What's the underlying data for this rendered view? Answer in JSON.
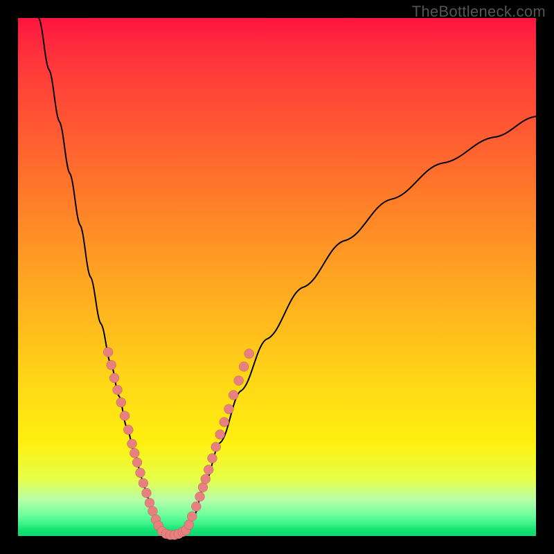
{
  "watermark": "TheBottleneck.com",
  "chart_data": {
    "type": "line",
    "title": "",
    "xlabel": "",
    "ylabel": "",
    "xlim": [
      0,
      1
    ],
    "ylim": [
      0,
      1
    ],
    "background_gradient": [
      "#ff143f",
      "#ff7a2a",
      "#ffd617",
      "#fff010",
      "#12d86f"
    ],
    "series": [
      {
        "name": "left-branch",
        "x": [
          0.04,
          0.06,
          0.08,
          0.1,
          0.12,
          0.14,
          0.16,
          0.18,
          0.195,
          0.21,
          0.225,
          0.24,
          0.25,
          0.26,
          0.268,
          0.276
        ],
        "y": [
          1.0,
          0.9,
          0.8,
          0.7,
          0.6,
          0.5,
          0.41,
          0.33,
          0.27,
          0.21,
          0.16,
          0.11,
          0.075,
          0.045,
          0.022,
          0.01
        ]
      },
      {
        "name": "valley-floor",
        "x": [
          0.276,
          0.285,
          0.295,
          0.305,
          0.315,
          0.326
        ],
        "y": [
          0.01,
          0.004,
          0.002,
          0.002,
          0.004,
          0.01
        ]
      },
      {
        "name": "right-branch",
        "x": [
          0.326,
          0.34,
          0.36,
          0.39,
          0.43,
          0.48,
          0.55,
          0.63,
          0.72,
          0.82,
          0.92,
          1.0
        ],
        "y": [
          0.01,
          0.04,
          0.1,
          0.18,
          0.28,
          0.38,
          0.48,
          0.57,
          0.65,
          0.72,
          0.77,
          0.81
        ]
      }
    ],
    "dots_left": [
      {
        "x": 0.174,
        "y": 0.355
      },
      {
        "x": 0.18,
        "y": 0.33
      },
      {
        "x": 0.186,
        "y": 0.305
      },
      {
        "x": 0.192,
        "y": 0.282
      },
      {
        "x": 0.199,
        "y": 0.258
      },
      {
        "x": 0.206,
        "y": 0.232
      },
      {
        "x": 0.213,
        "y": 0.205
      },
      {
        "x": 0.22,
        "y": 0.178
      },
      {
        "x": 0.225,
        "y": 0.16
      },
      {
        "x": 0.23,
        "y": 0.142
      },
      {
        "x": 0.236,
        "y": 0.122
      },
      {
        "x": 0.242,
        "y": 0.102
      },
      {
        "x": 0.248,
        "y": 0.083
      },
      {
        "x": 0.254,
        "y": 0.064
      },
      {
        "x": 0.26,
        "y": 0.048
      },
      {
        "x": 0.266,
        "y": 0.032
      },
      {
        "x": 0.271,
        "y": 0.02
      }
    ],
    "dots_floor": [
      {
        "x": 0.278,
        "y": 0.009
      },
      {
        "x": 0.286,
        "y": 0.004
      },
      {
        "x": 0.294,
        "y": 0.002
      },
      {
        "x": 0.302,
        "y": 0.002
      },
      {
        "x": 0.31,
        "y": 0.004
      },
      {
        "x": 0.318,
        "y": 0.008
      },
      {
        "x": 0.324,
        "y": 0.011
      }
    ],
    "dots_right": [
      {
        "x": 0.33,
        "y": 0.022
      },
      {
        "x": 0.336,
        "y": 0.038
      },
      {
        "x": 0.344,
        "y": 0.057
      },
      {
        "x": 0.351,
        "y": 0.076
      },
      {
        "x": 0.357,
        "y": 0.094
      },
      {
        "x": 0.362,
        "y": 0.11
      },
      {
        "x": 0.368,
        "y": 0.128
      },
      {
        "x": 0.375,
        "y": 0.15
      },
      {
        "x": 0.382,
        "y": 0.172
      },
      {
        "x": 0.39,
        "y": 0.196
      },
      {
        "x": 0.398,
        "y": 0.22
      },
      {
        "x": 0.407,
        "y": 0.245
      },
      {
        "x": 0.416,
        "y": 0.272
      },
      {
        "x": 0.426,
        "y": 0.3
      },
      {
        "x": 0.436,
        "y": 0.327
      },
      {
        "x": 0.446,
        "y": 0.352
      }
    ]
  }
}
